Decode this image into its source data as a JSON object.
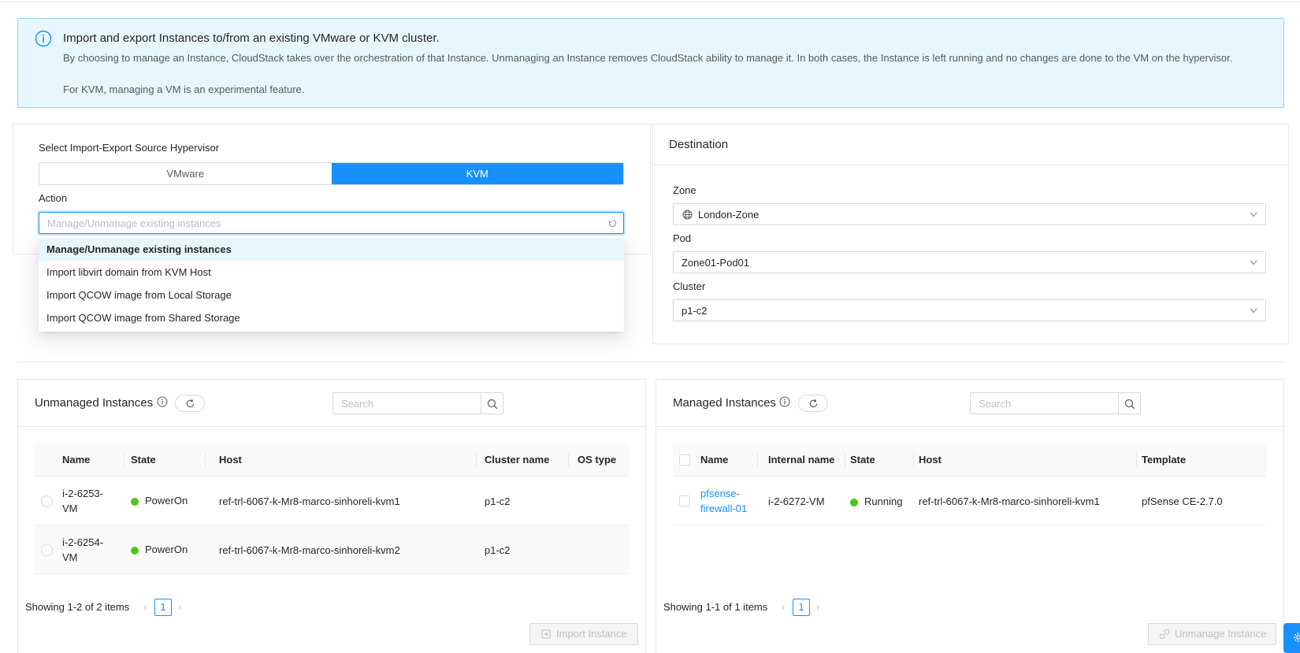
{
  "alert": {
    "title": "Import and export Instances to/from an existing VMware or KVM cluster.",
    "description1": "By choosing to manage an Instance, CloudStack takes over the orchestration of that Instance. Unmanaging an Instance removes CloudStack ability to manage it. In both cases, the Instance is left running and no changes are done to the VM on the hypervisor.",
    "description2": "For KVM, managing a VM is an experimental feature."
  },
  "source": {
    "label": "Select Import-Export Source Hypervisor",
    "options": [
      "VMware",
      "KVM"
    ],
    "selected": "KVM",
    "action_label": "Action",
    "action_placeholder": "Manage/Unmanage existing instances",
    "action_options": [
      "Manage/Unmanage existing instances",
      "Import libvirt domain from KVM Host",
      "Import QCOW image from Local Storage",
      "Import QCOW image from Shared Storage"
    ]
  },
  "destination": {
    "title": "Destination",
    "zone_label": "Zone",
    "zone_value": "London-Zone",
    "pod_label": "Pod",
    "pod_value": "Zone01-Pod01",
    "cluster_label": "Cluster",
    "cluster_value": "p1-c2"
  },
  "unmanaged": {
    "title": "Unmanaged Instances",
    "search_placeholder": "Search",
    "columns": [
      "Name",
      "State",
      "Host",
      "Cluster name",
      "OS type"
    ],
    "rows": [
      {
        "name_line1": "i-2-6253-",
        "name_line2": "VM",
        "state": "PowerOn",
        "host": "ref-trl-6067-k-Mr8-marco-sinhoreli-kvm1",
        "cluster": "p1-c2",
        "os": ""
      },
      {
        "name_line1": "i-2-6254-",
        "name_line2": "VM",
        "state": "PowerOn",
        "host": "ref-trl-6067-k-Mr8-marco-sinhoreli-kvm2",
        "cluster": "p1-c2",
        "os": ""
      }
    ],
    "showing": "Showing 1-2 of 2 items",
    "page": "1",
    "action_button": "Import Instance"
  },
  "managed": {
    "title": "Managed Instances",
    "search_placeholder": "Search",
    "columns": [
      "Name",
      "Internal name",
      "State",
      "Host",
      "Template"
    ],
    "rows": [
      {
        "name_line1": "pfsense-",
        "name_line2": "firewall-01",
        "internal": "i-2-6272-VM",
        "state": "Running",
        "host": "ref-trl-6067-k-Mr8-marco-sinhoreli-kvm1",
        "template": "pfSense CE-2.7.0"
      }
    ],
    "showing": "Showing 1-1 of 1 items",
    "page": "1",
    "action_button": "Unmanage Instance"
  },
  "colors": {
    "primary": "#1890ff",
    "success": "#52c41a",
    "alert_bg": "#e6f7ff",
    "alert_border": "#91d5ff"
  },
  "icons": [
    "info-circle-icon",
    "loading-icon",
    "global-icon",
    "chevron-down-icon",
    "info-icon",
    "reload-icon",
    "search-icon",
    "left-arrow-icon",
    "right-arrow-icon",
    "import-icon",
    "disconnect-icon",
    "setting-icon"
  ]
}
